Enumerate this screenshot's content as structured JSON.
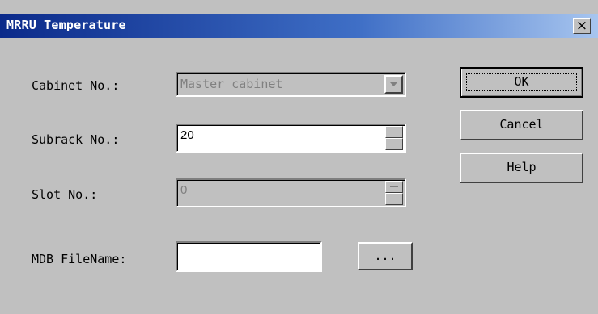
{
  "window": {
    "title": "MRRU Temperature",
    "close_label": "×"
  },
  "fields": {
    "cabinet": {
      "label": "Cabinet No.:",
      "value": "Master cabinet"
    },
    "subrack": {
      "label": "Subrack No.:",
      "value": "20"
    },
    "slot": {
      "label": "Slot No.:",
      "value": "0"
    },
    "mdb": {
      "label": "MDB FileName:",
      "value": ""
    }
  },
  "buttons": {
    "ok": "OK",
    "cancel": "Cancel",
    "help": "Help",
    "browse": "..."
  },
  "colors": {
    "face": "#c0c0c0",
    "title_start": "#0b2a8a",
    "title_end": "#a7c5ef",
    "disabled_text": "#808080"
  },
  "icons": {
    "dropdown": "chevron-down-icon",
    "spin": "spin-arrows-icon",
    "close": "close-icon"
  }
}
